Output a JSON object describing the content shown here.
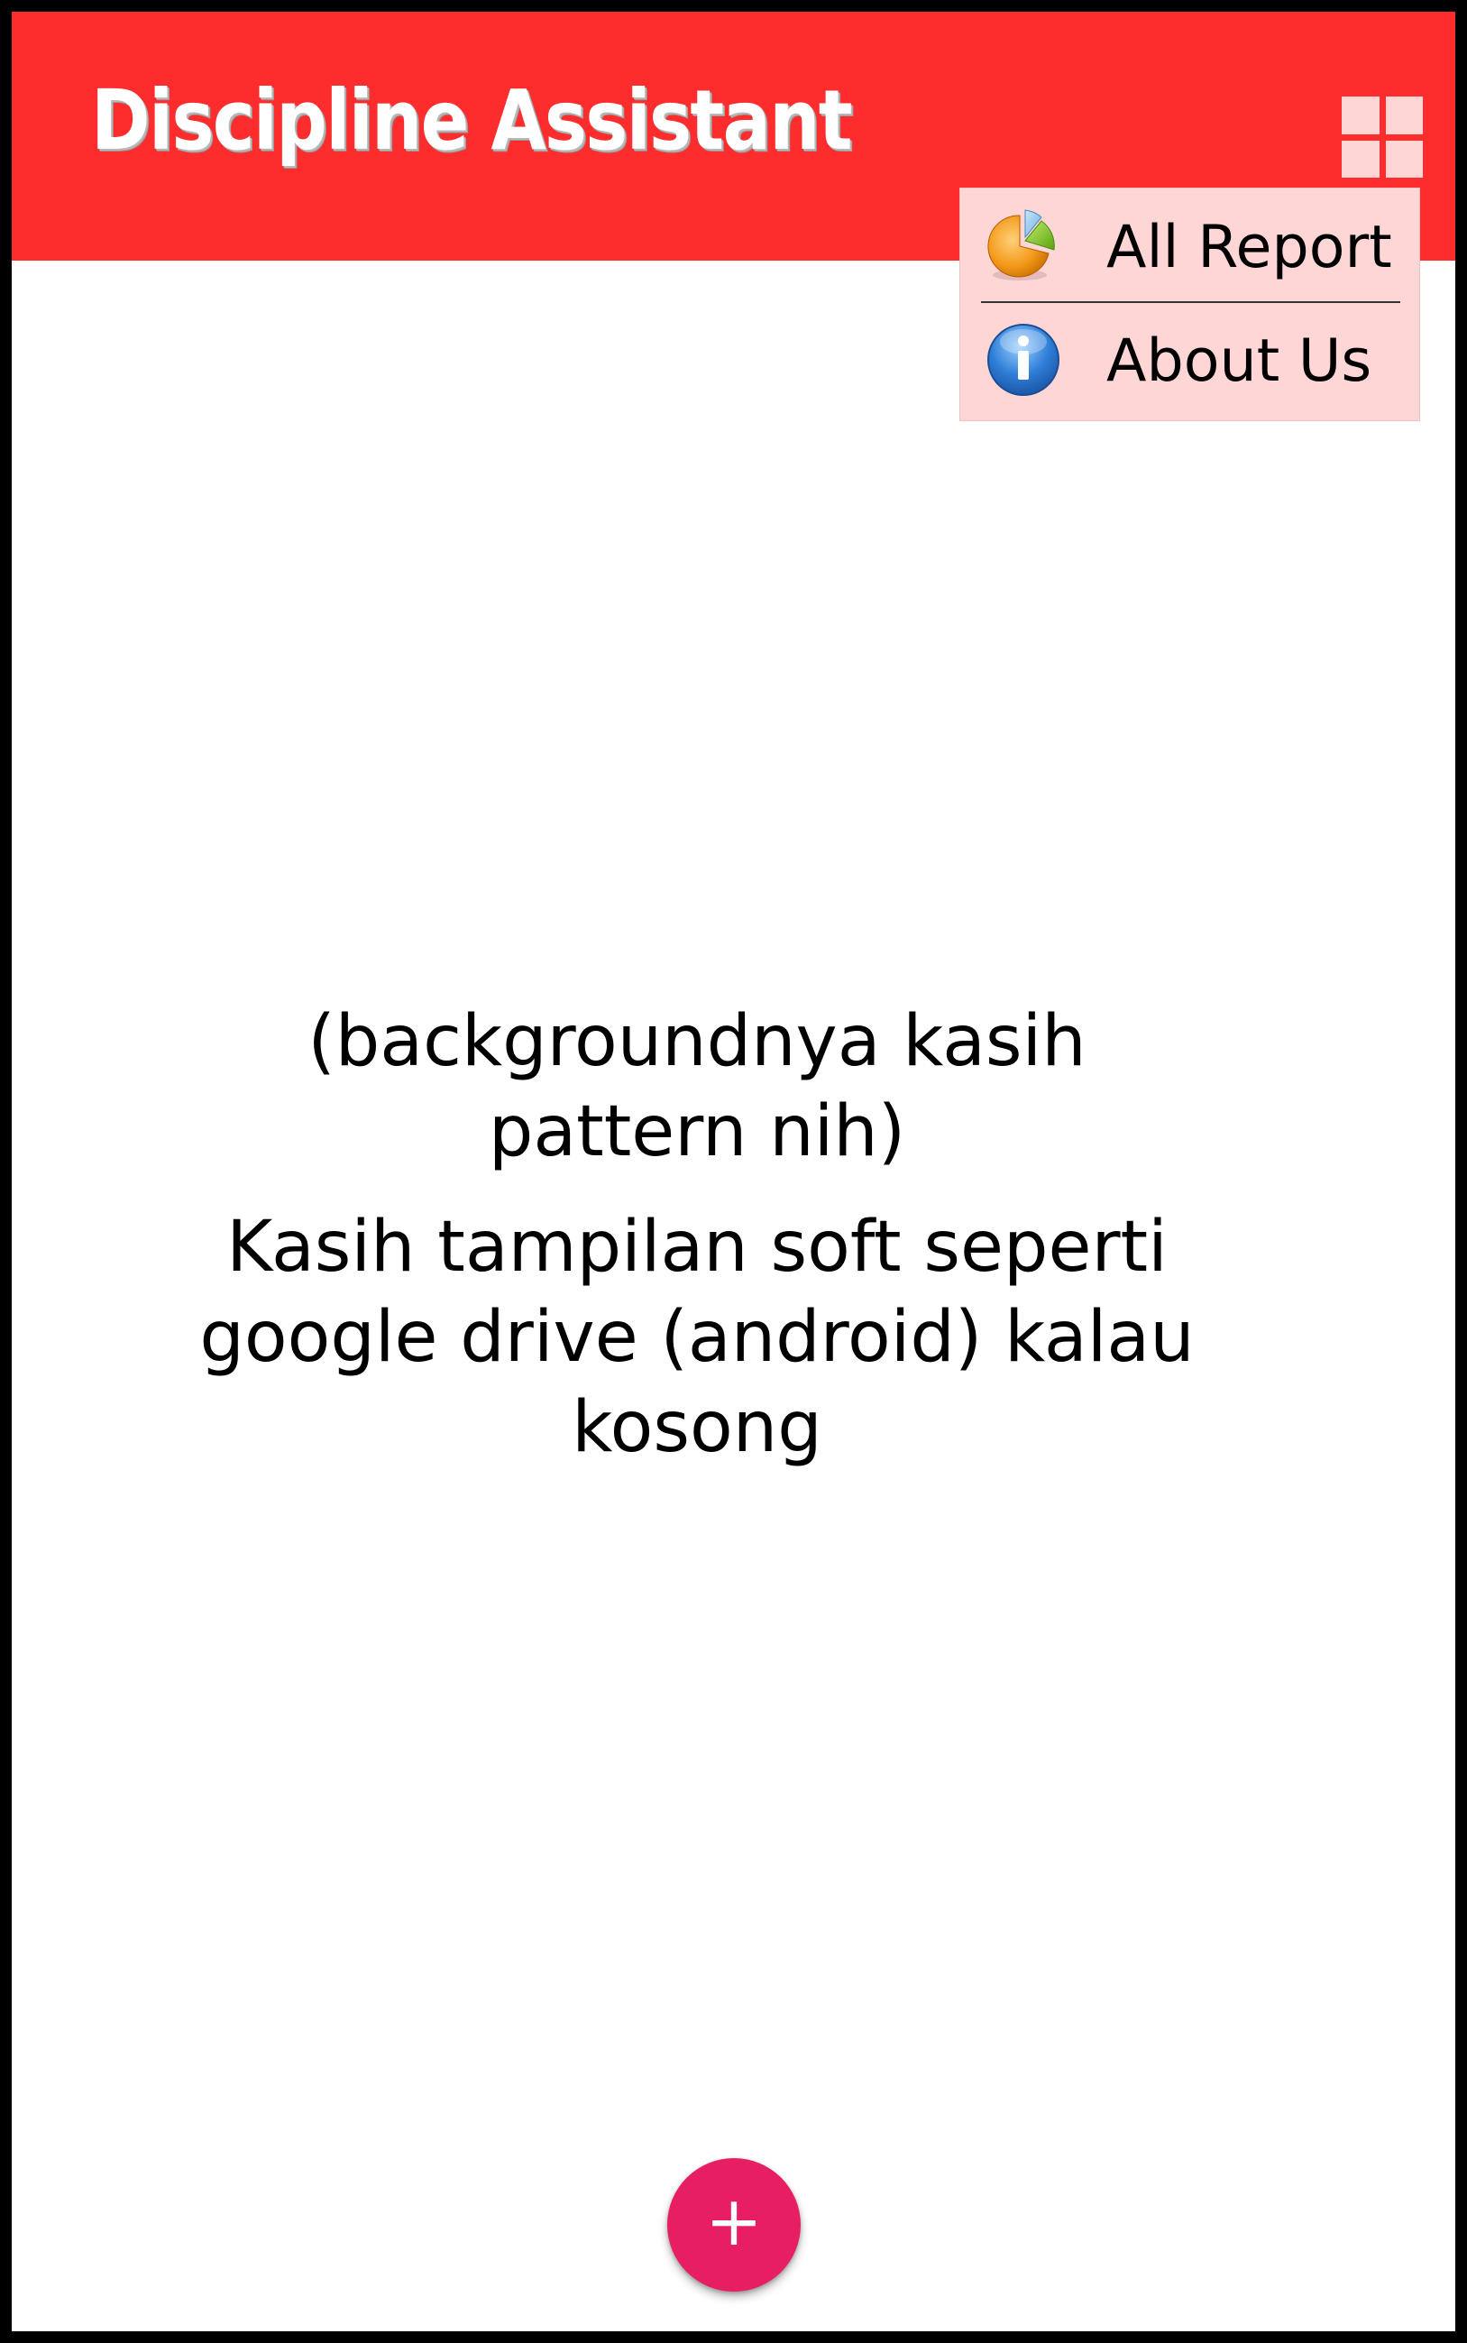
{
  "app_bar": {
    "title": "Discipline Assistant",
    "menu_icon": "grid-menu-icon",
    "background_color": "#fe2d2d"
  },
  "menu": {
    "items": [
      {
        "label": "All Report",
        "icon": "pie-chart-icon"
      },
      {
        "label": "About Us",
        "icon": "info-icon"
      }
    ],
    "background_color": "#ffd6d6"
  },
  "empty_state": {
    "note_pattern": "(backgroundnya kasih pattern nih)",
    "note_soft": "Kasih tampilan soft seperti google drive (android) kalau kosong"
  },
  "fab": {
    "label": "+",
    "icon": "plus-icon",
    "color": "#e71e63"
  }
}
